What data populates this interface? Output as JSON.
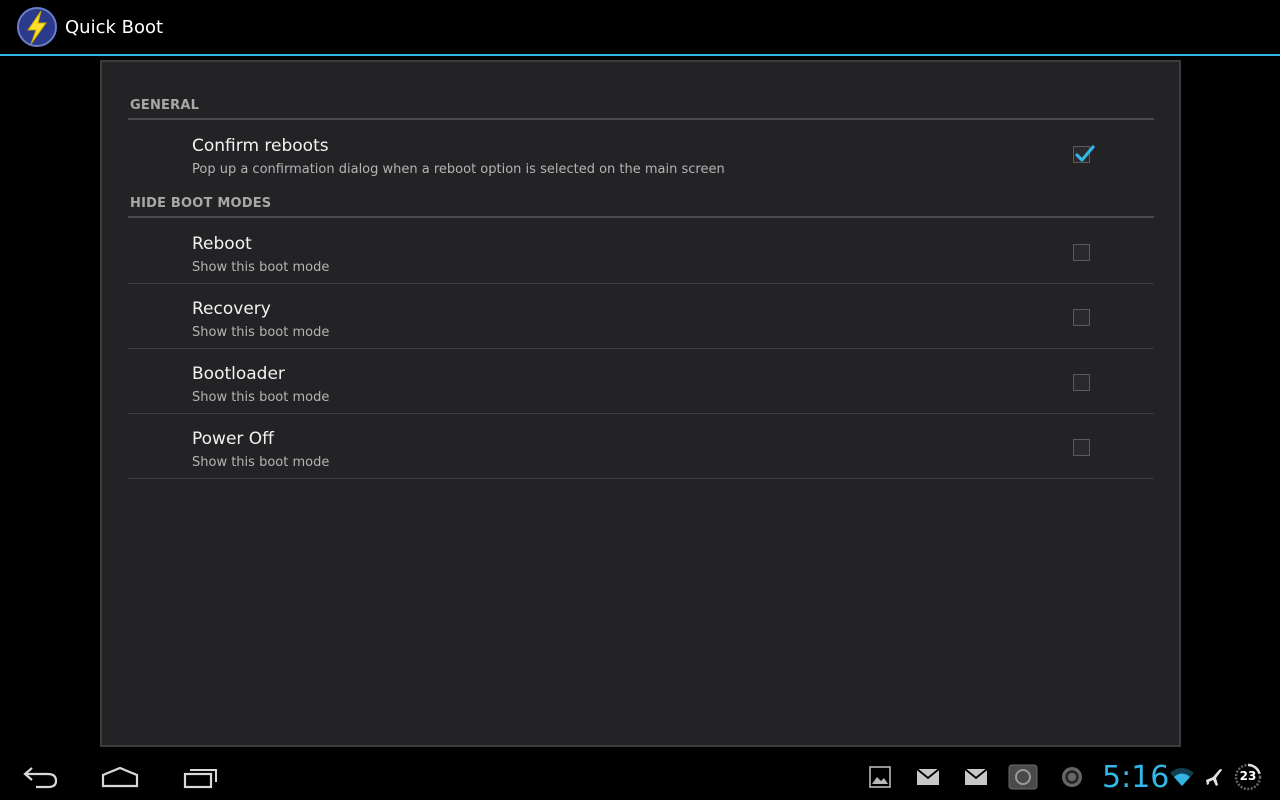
{
  "app": {
    "title": "Quick Boot"
  },
  "sections": [
    {
      "header": "GENERAL",
      "items": [
        {
          "title": "Confirm reboots",
          "summary": "Pop up a confirmation dialog when a reboot option is selected on the main screen",
          "checked": true
        }
      ]
    },
    {
      "header": "HIDE BOOT MODES",
      "items": [
        {
          "title": "Reboot",
          "summary": "Show this boot mode",
          "checked": false
        },
        {
          "title": "Recovery",
          "summary": "Show this boot mode",
          "checked": false
        },
        {
          "title": "Bootloader",
          "summary": "Show this boot mode",
          "checked": false
        },
        {
          "title": "Power Off",
          "summary": "Show this boot mode",
          "checked": false
        }
      ]
    }
  ],
  "system_bar": {
    "clock": "5:16",
    "battery_level": "23",
    "nav_icons": [
      "back-icon",
      "home-icon",
      "recent-apps-icon"
    ],
    "notification_icons": [
      "gallery-icon",
      "email-icon",
      "email-icon",
      "app-notification-icon",
      "sync-icon"
    ],
    "status_icons": [
      "wifi-icon",
      "airplane-mode-icon",
      "battery-icon"
    ]
  },
  "colors": {
    "accent": "#33b5e5",
    "panel_bg": "#232326",
    "background": "#000000"
  }
}
